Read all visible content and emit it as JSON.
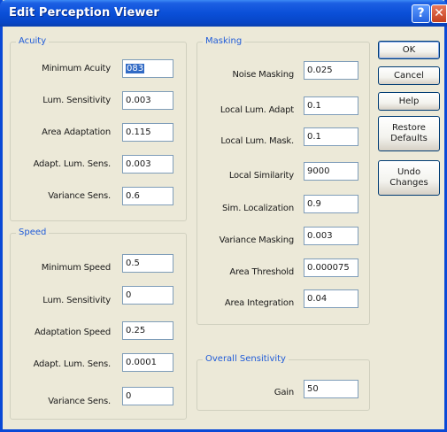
{
  "window": {
    "title": "Edit Perception Viewer",
    "help_glyph": "?",
    "close_glyph": "✕"
  },
  "acuity": {
    "legend": "Acuity",
    "fields": [
      {
        "label": "Minimum Acuity",
        "value": "083",
        "selected": true
      },
      {
        "label": "Lum. Sensitivity",
        "value": "0.003"
      },
      {
        "label": "Area Adaptation",
        "value": "0.115"
      },
      {
        "label": "Adapt. Lum. Sens.",
        "value": "0.003"
      },
      {
        "label": "Variance Sens.",
        "value": "0.6"
      }
    ]
  },
  "speed": {
    "legend": "Speed",
    "fields": [
      {
        "label": "Minimum Speed",
        "value": "0.5"
      },
      {
        "label": "Lum. Sensitivity",
        "value": "0"
      },
      {
        "label": "Adaptation Speed",
        "value": "0.25"
      },
      {
        "label": "Adapt. Lum. Sens.",
        "value": "0.0001"
      },
      {
        "label": "Variance Sens.",
        "value": "0"
      }
    ]
  },
  "masking": {
    "legend": "Masking",
    "fields": [
      {
        "label": "Noise Masking",
        "value": "0.025"
      },
      {
        "label": "Local Lum. Adapt",
        "value": "0.1"
      },
      {
        "label": "Local Lum. Mask.",
        "value": "0.1"
      },
      {
        "label": "Local Similarity",
        "value": "9000"
      },
      {
        "label": "Sim. Localization",
        "value": "0.9"
      },
      {
        "label": "Variance Masking",
        "value": "0.003"
      },
      {
        "label": "Area Threshold",
        "value": "0.000075"
      },
      {
        "label": "Area Integration",
        "value": "0.04"
      }
    ]
  },
  "overall": {
    "legend": "Overall Sensitivity",
    "fields": [
      {
        "label": "Gain",
        "value": "50"
      }
    ]
  },
  "buttons": {
    "ok": "OK",
    "cancel": "Cancel",
    "help": "Help",
    "restore_line1": "Restore",
    "restore_line2": "Defaults",
    "undo_line1": "Undo",
    "undo_line2": "Changes"
  }
}
